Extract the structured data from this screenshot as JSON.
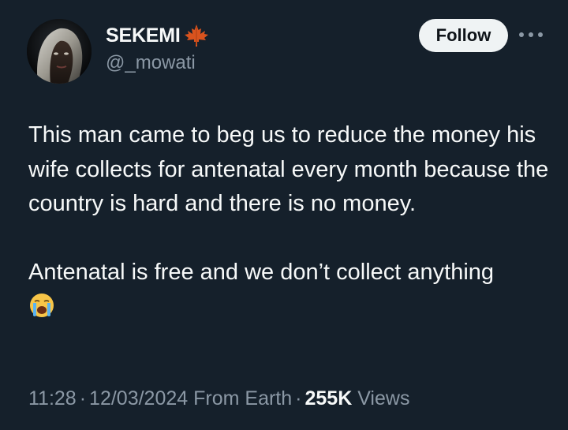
{
  "author": {
    "display_name": "SEKEMI",
    "handle": "@_mowati",
    "badge_icon": "maple-leaf-icon",
    "avatar_icon": "profile-avatar"
  },
  "actions": {
    "follow_label": "Follow",
    "more_icon": "more-options-icon"
  },
  "tweet": {
    "paragraph_1": "This man came to beg us to reduce the money his wife collects for antenatal every month because the country is hard and there is no money.",
    "paragraph_2": "Antenatal is free and we don’t collect anything",
    "emoji_icon": "loudly-crying-face-icon"
  },
  "meta": {
    "time": "11:28",
    "separator": "·",
    "date": "12/03/2024",
    "source": "From Earth",
    "views_count": "255K",
    "views_label": "Views"
  },
  "colors": {
    "background": "#15202b",
    "text_primary": "#f7f9f9",
    "text_secondary": "#8b98a5",
    "follow_bg": "#eff3f4",
    "maple_leaf": "#d9531e"
  }
}
